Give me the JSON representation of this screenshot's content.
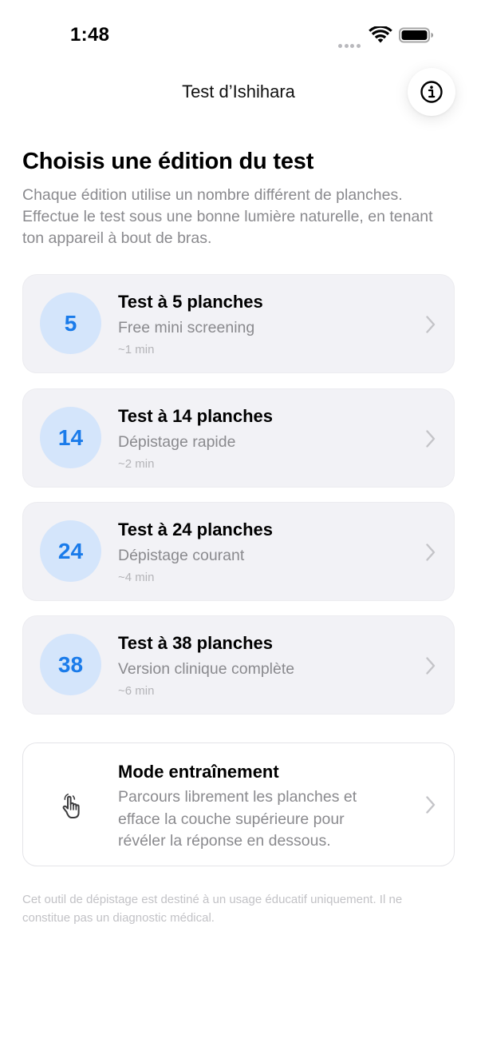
{
  "status_bar": {
    "time": "1:48"
  },
  "nav": {
    "title": "Test d’Ishihara"
  },
  "header": {
    "heading": "Choisis une édition du test",
    "subtitle": "Chaque édition utilise un nombre différent de planches. Effectue le test sous une bonne lumière naturelle, en tenant ton appareil à bout de bras."
  },
  "editions": [
    {
      "badge": "5",
      "title": "Test à 5 planches",
      "description": "Free mini screening",
      "duration": "~1 min"
    },
    {
      "badge": "14",
      "title": "Test à 14 planches",
      "description": "Dépistage rapide",
      "duration": "~2 min"
    },
    {
      "badge": "24",
      "title": "Test à 24 planches",
      "description": "Dépistage courant",
      "duration": "~4 min"
    },
    {
      "badge": "38",
      "title": "Test à 38 planches",
      "description": "Version clinique complète",
      "duration": "~6 min"
    }
  ],
  "practice": {
    "title": "Mode entraînement",
    "description": "Parcours librement les planches et efface la couche supérieure pour révéler la réponse en dessous.",
    "icon": "hand-pointer-icon"
  },
  "disclaimer": "Cet outil de dépistage est destiné à un usage éducatif uniquement. Il ne constitue pas un diagnostic médical.",
  "icons": {
    "info": "info-circle-icon",
    "chevron": "chevron-right-icon",
    "wifi": "wifi-icon",
    "battery": "battery-icon"
  },
  "colors": {
    "accent": "#1a7bea",
    "badge_background": "#d4e5fb",
    "card_background": "#f2f2f6",
    "secondary_text": "#8a8a8e"
  }
}
